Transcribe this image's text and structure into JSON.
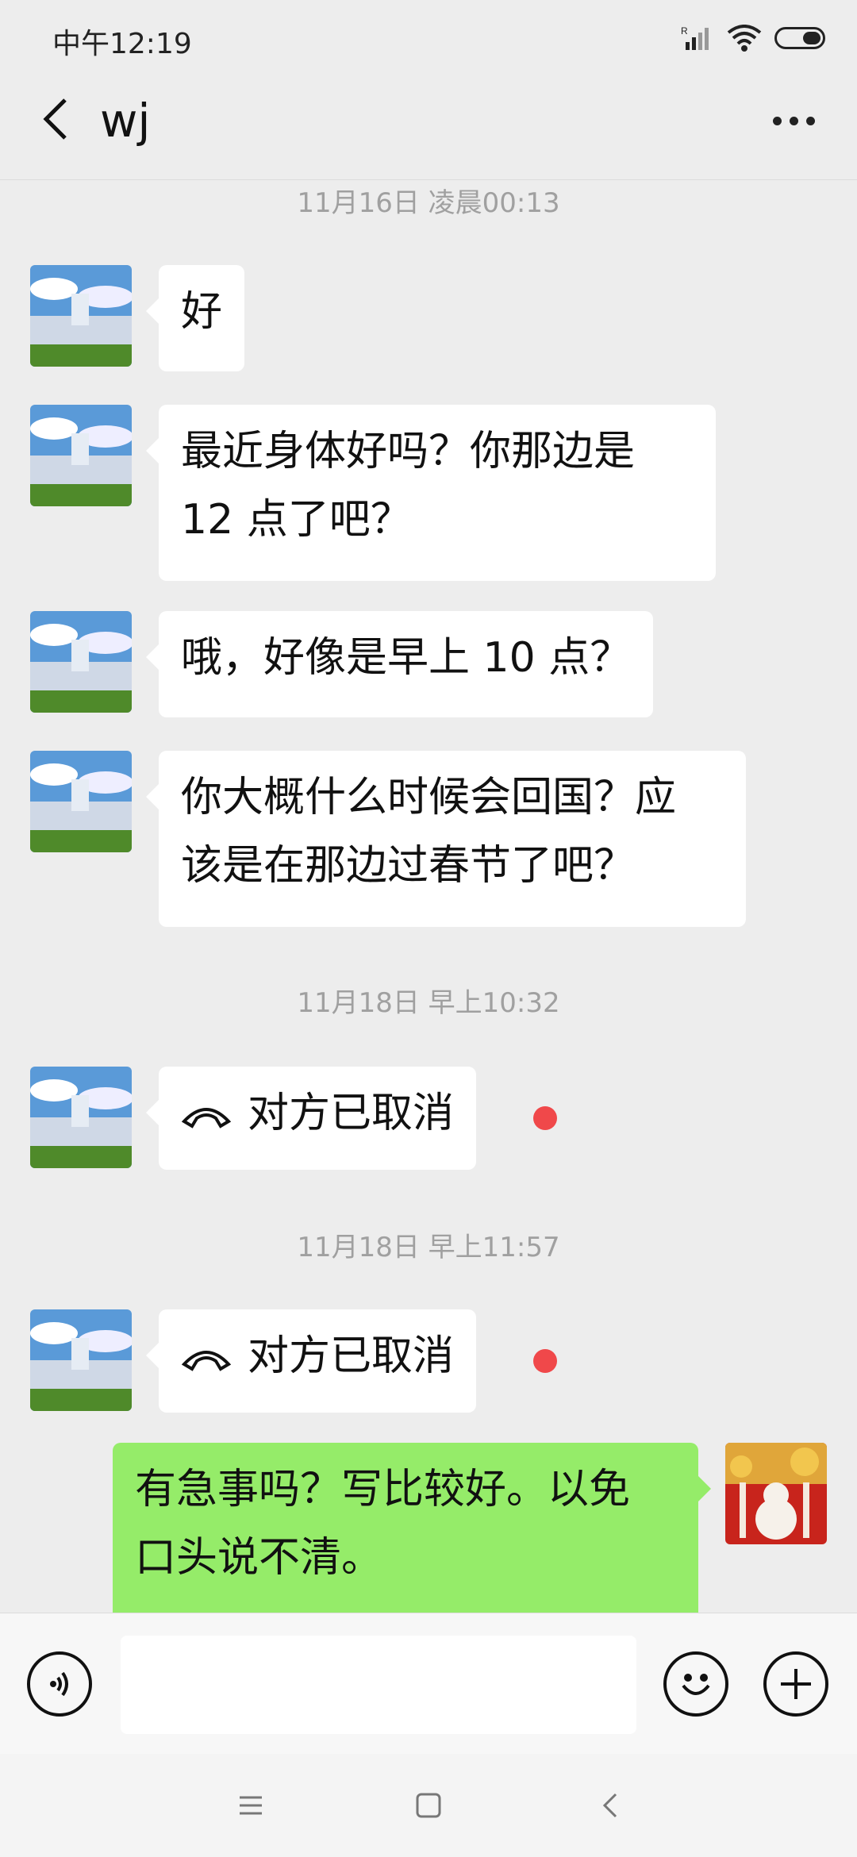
{
  "status_bar": {
    "time": "中午12:19",
    "signal_icon": "signal-icon",
    "wifi_icon": "wifi-icon",
    "battery_icon": "battery-icon"
  },
  "header": {
    "title": "wj",
    "back_icon": "chevron-left-icon",
    "more_icon": "more-dots-icon"
  },
  "messages": [
    {
      "type": "timestamp",
      "text": "11月16日 凌晨00:13"
    },
    {
      "type": "text",
      "side": "left",
      "text": "好"
    },
    {
      "type": "text",
      "side": "left",
      "lines": [
        "最近身体好吗？你那边是",
        "12 点了吧？"
      ]
    },
    {
      "type": "text",
      "side": "left",
      "text": "哦，好像是早上 10 点？"
    },
    {
      "type": "text",
      "side": "left",
      "lines": [
        "你大概什么时候会回国？应",
        "该是在那边过春节了吧？"
      ]
    },
    {
      "type": "timestamp",
      "text": "11月18日 早上10:32"
    },
    {
      "type": "call",
      "side": "left",
      "text": "对方已取消",
      "unread": true
    },
    {
      "type": "timestamp",
      "text": "11月18日 早上11:57"
    },
    {
      "type": "call",
      "side": "left",
      "text": "对方已取消",
      "unread": true
    },
    {
      "type": "text",
      "side": "right",
      "lines": [
        "有急事吗？写比较好。以免",
        "口头说不清。"
      ]
    }
  ],
  "input_bar": {
    "voice_icon": "voice-icon",
    "text_value": "",
    "emoji_icon": "emoji-icon",
    "plus_icon": "plus-icon"
  },
  "nav_bar": {
    "menu_icon": "menu-icon",
    "home_icon": "home-square-icon",
    "back_icon": "back-triangle-icon"
  },
  "colors": {
    "background": "#ededed",
    "bubble_left": "#ffffff",
    "bubble_right": "#95ec69",
    "unread_dot": "#f0484a",
    "timestamp_text": "#a0a0a0"
  }
}
